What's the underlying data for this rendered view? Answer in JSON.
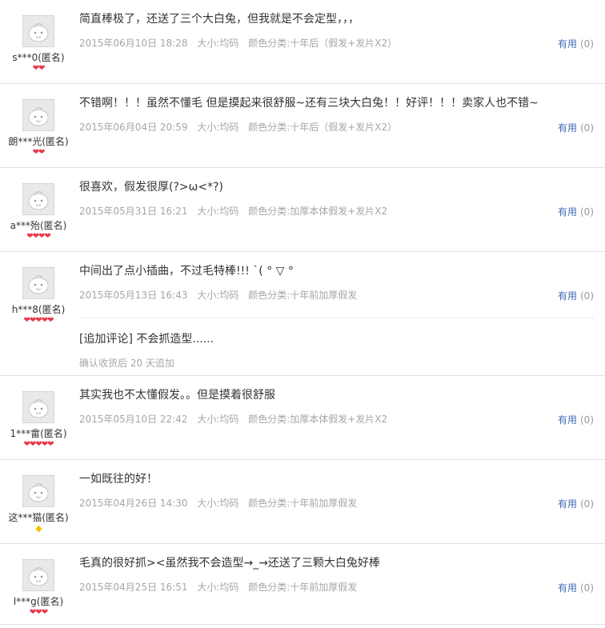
{
  "useful_label": "有用",
  "reviews": [
    {
      "user": "s***0(匿名)",
      "rank": {
        "type": "heart",
        "count": 2
      },
      "content": "简直棒极了，还送了三个大白兔，但我就是不会定型，，，",
      "date": "2015年06月10日 18:28",
      "size": "大小:均码",
      "color": "颜色分类:十年后（假发+发片X2）",
      "useful_count": "(0)"
    },
    {
      "user": "朗***光(匿名)",
      "rank": {
        "type": "heart",
        "count": 2
      },
      "content": "不错啊！！！虽然不懂毛 但是摸起来很舒服~还有三块大白兔！！好评！！！卖家人也不错~",
      "date": "2015年06月04日 20:59",
      "size": "大小:均码",
      "color": "颜色分类:十年后（假发+发片X2）",
      "useful_count": "(0)"
    },
    {
      "user": "a***殆(匿名)",
      "rank": {
        "type": "heart",
        "count": 4
      },
      "content": "很喜欢，假发很厚(?>ω<*?)",
      "date": "2015年05月31日 16:21",
      "size": "大小:均码",
      "color": "颜色分类:加厚本体假发+发片X2",
      "useful_count": "(0)"
    },
    {
      "user": "h***8(匿名)",
      "rank": {
        "type": "heart",
        "count": 5
      },
      "content": "中间出了点小插曲，不过毛特棒!!! ˋ( ° ▽ °",
      "date": "2015年05月13日 16:43",
      "size": "大小:均码",
      "color": "颜色分类:十年前加厚假发",
      "useful_count": "(0)",
      "append": {
        "text": "[追加评论] 不会抓造型......",
        "note": "确认收货后 20 天追加"
      }
    },
    {
      "user": "1***畲(匿名)",
      "rank": {
        "type": "heart",
        "count": 5
      },
      "content": "其实我也不太懂假发。。但是摸着很舒服",
      "date": "2015年05月10日 22:42",
      "size": "大小:均码",
      "color": "颜色分类:加厚本体假发+发片X2",
      "useful_count": "(0)"
    },
    {
      "user": "这***猫(匿名)",
      "rank": {
        "type": "diamond",
        "count": 1
      },
      "content": "一如既往的好！",
      "date": "2015年04月26日 14:30",
      "size": "大小:均码",
      "color": "颜色分类:十年前加厚假发",
      "useful_count": "(0)"
    },
    {
      "user": "l***g(匿名)",
      "rank": {
        "type": "heart",
        "count": 3
      },
      "content": "毛真的很好抓><虽然我不会造型→_→还送了三颗大白兔好棒",
      "date": "2015年04月25日 16:51",
      "size": "大小:均码",
      "color": "颜色分类:十年前加厚假发",
      "useful_count": "(0)"
    }
  ],
  "colors": {
    "useful_link": "#3d6ab3",
    "heart": "#e8394a",
    "diamond": "#f2c200",
    "meta_text": "#a6a6a6",
    "divider": "#e0e0e0"
  },
  "icons": {
    "avatar": "default-avatar-icon",
    "heart": "heart-rank-icon",
    "diamond": "diamond-rank-icon"
  }
}
